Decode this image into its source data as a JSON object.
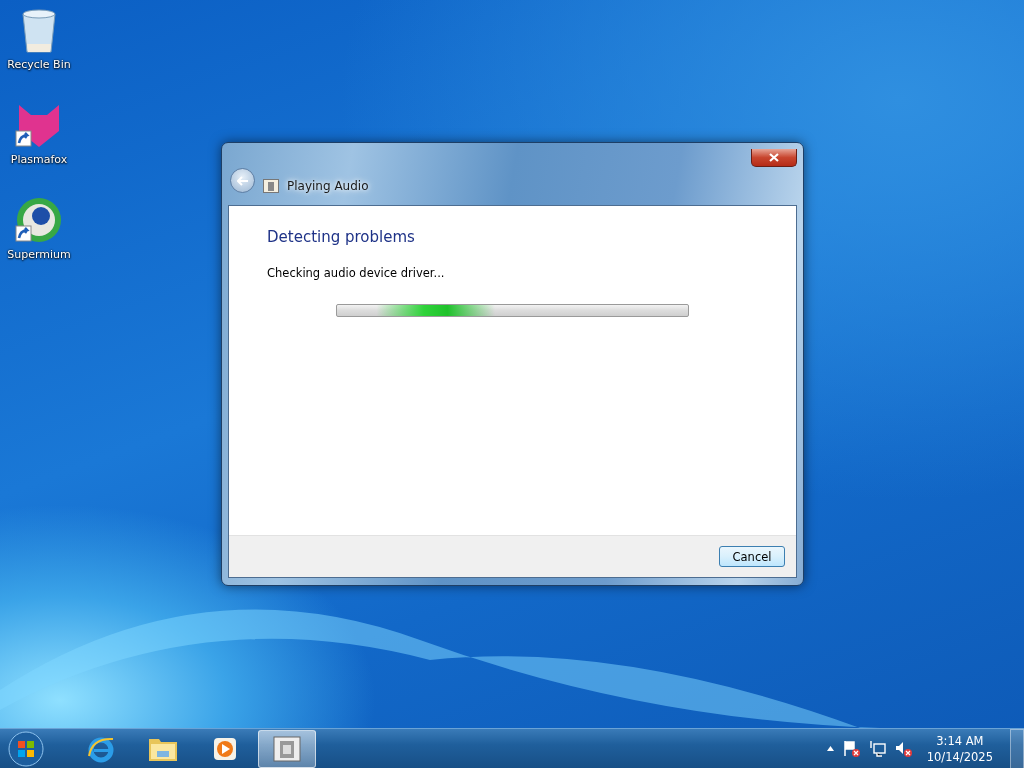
{
  "desktop_icons": [
    {
      "label": "Recycle Bin",
      "kind": "bin",
      "shortcut": false
    },
    {
      "label": "Plasmafox",
      "kind": "fox",
      "shortcut": true
    },
    {
      "label": "Supermium",
      "kind": "globe",
      "shortcut": true
    }
  ],
  "dialog": {
    "title": "Playing Audio",
    "heading": "Detecting problems",
    "status": "Checking audio device driver...",
    "progress": {
      "level": 0.45
    },
    "buttons": [
      "Cancel"
    ]
  },
  "taskbar": {
    "items": [
      {
        "kind": "browser",
        "selected": false
      },
      {
        "kind": "folder",
        "selected": false
      },
      {
        "kind": "media",
        "selected": false
      },
      {
        "kind": "troubleshooter",
        "selected": true
      }
    ],
    "tray_icons": [
      {
        "kind": "flag"
      },
      {
        "kind": "network"
      },
      {
        "kind": "speaker"
      }
    ],
    "clock": {
      "time": "3:14 AM",
      "date": "10/14/2025"
    }
  }
}
